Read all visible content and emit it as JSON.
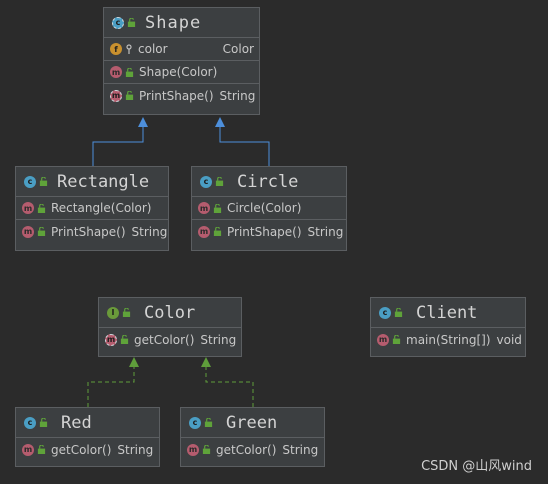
{
  "classes": {
    "shape": {
      "name": "Shape",
      "icon": "abstract-class-icon",
      "field": {
        "name": "color",
        "type": "Color"
      },
      "methods": [
        {
          "name": "Shape(Color)",
          "type": ""
        },
        {
          "name": "PrintShape()",
          "type": "String"
        }
      ]
    },
    "rectangle": {
      "name": "Rectangle",
      "methods": [
        {
          "name": "Rectangle(Color)",
          "type": ""
        },
        {
          "name": "PrintShape()",
          "type": "String"
        }
      ]
    },
    "circle": {
      "name": "Circle",
      "methods": [
        {
          "name": "Circle(Color)",
          "type": ""
        },
        {
          "name": "PrintShape()",
          "type": "String"
        }
      ]
    },
    "color": {
      "name": "Color",
      "icon": "interface-icon",
      "methods": [
        {
          "name": "getColor()",
          "type": "String"
        }
      ]
    },
    "client": {
      "name": "Client",
      "methods": [
        {
          "name": "main(String[])",
          "type": "void"
        }
      ]
    },
    "red": {
      "name": "Red",
      "methods": [
        {
          "name": "getColor()",
          "type": "String"
        }
      ]
    },
    "green": {
      "name": "Green",
      "methods": [
        {
          "name": "getColor()",
          "type": "String"
        }
      ]
    }
  },
  "icon_letters": {
    "class": "c",
    "interface": "I",
    "method": "m",
    "field": "f"
  },
  "colors": {
    "inheritance_arrow": "#4d8fdb",
    "implements_arrow": "#5f9e3b",
    "background": "#2b2b2b"
  },
  "watermark": "CSDN @山风wind"
}
